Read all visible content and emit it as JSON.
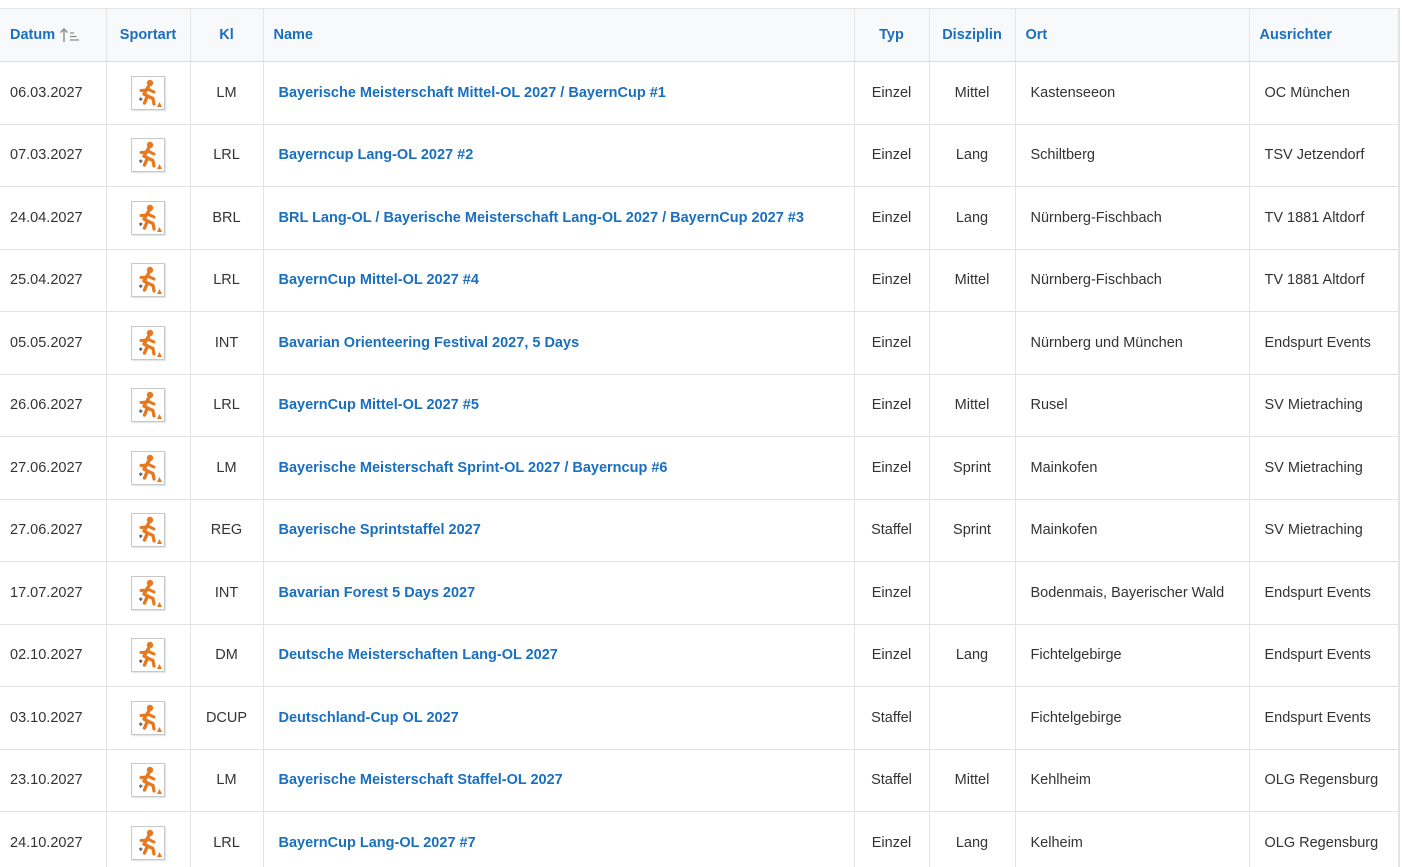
{
  "headers": {
    "datum": "Datum",
    "sportart": "Sportart",
    "kl": "Kl",
    "name": "Name",
    "typ": "Typ",
    "disziplin": "Disziplin",
    "ort": "Ort",
    "ausrichter": "Ausrichter"
  },
  "sort": {
    "column": "Datum",
    "direction": "ascending",
    "icon": "sort-ascending-icon"
  },
  "sport_icon": "orienteering-runner-icon",
  "colors": {
    "link": "#1a6fbf",
    "icon_orange": "#e8781e",
    "header_bg": "#f8f9fb"
  },
  "rows": [
    {
      "datum": "06.03.2027",
      "kl": "LM",
      "name": "Bayerische Meisterschaft Mittel-OL 2027 / BayernCup #1",
      "typ": "Einzel",
      "disziplin": "Mittel",
      "ort": "Kastenseeon",
      "ausrichter": "OC München"
    },
    {
      "datum": "07.03.2027",
      "kl": "LRL",
      "name": "Bayerncup Lang-OL 2027 #2",
      "typ": "Einzel",
      "disziplin": "Lang",
      "ort": "Schiltberg",
      "ausrichter": "TSV Jetzendorf"
    },
    {
      "datum": "24.04.2027",
      "kl": "BRL",
      "name": "BRL Lang-OL / Bayerische Meisterschaft Lang-OL 2027 / BayernCup 2027 #3",
      "typ": "Einzel",
      "disziplin": "Lang",
      "ort": "Nürnberg-Fischbach",
      "ausrichter": "TV 1881 Altdorf"
    },
    {
      "datum": "25.04.2027",
      "kl": "LRL",
      "name": "BayernCup Mittel-OL 2027 #4",
      "typ": "Einzel",
      "disziplin": "Mittel",
      "ort": "Nürnberg-Fischbach",
      "ausrichter": "TV 1881 Altdorf"
    },
    {
      "datum": "05.05.2027",
      "kl": "INT",
      "name": "Bavarian Orienteering Festival 2027, 5 Days",
      "typ": "Einzel",
      "disziplin": "",
      "ort": "Nürnberg und München",
      "ausrichter": "Endspurt Events"
    },
    {
      "datum": "26.06.2027",
      "kl": "LRL",
      "name": "BayernCup Mittel-OL 2027 #5",
      "typ": "Einzel",
      "disziplin": "Mittel",
      "ort": "Rusel",
      "ausrichter": "SV Mietraching"
    },
    {
      "datum": "27.06.2027",
      "kl": "LM",
      "name": "Bayerische Meisterschaft Sprint-OL 2027 / Bayerncup #6",
      "typ": "Einzel",
      "disziplin": "Sprint",
      "ort": "Mainkofen",
      "ausrichter": "SV Mietraching"
    },
    {
      "datum": "27.06.2027",
      "kl": "REG",
      "name": "Bayerische Sprintstaffel 2027",
      "typ": "Staffel",
      "disziplin": "Sprint",
      "ort": "Mainkofen",
      "ausrichter": "SV Mietraching"
    },
    {
      "datum": "17.07.2027",
      "kl": "INT",
      "name": "Bavarian Forest 5 Days 2027",
      "typ": "Einzel",
      "disziplin": "",
      "ort": "Bodenmais, Bayerischer Wald",
      "ausrichter": "Endspurt Events"
    },
    {
      "datum": "02.10.2027",
      "kl": "DM",
      "name": "Deutsche Meisterschaften Lang-OL 2027",
      "typ": "Einzel",
      "disziplin": "Lang",
      "ort": "Fichtelgebirge",
      "ausrichter": "Endspurt Events"
    },
    {
      "datum": "03.10.2027",
      "kl": "DCUP",
      "name": "Deutschland-Cup OL 2027",
      "typ": "Staffel",
      "disziplin": "",
      "ort": "Fichtelgebirge",
      "ausrichter": "Endspurt Events"
    },
    {
      "datum": "23.10.2027",
      "kl": "LM",
      "name": "Bayerische Meisterschaft Staffel-OL 2027",
      "typ": "Staffel",
      "disziplin": "Mittel",
      "ort": "Kehlheim",
      "ausrichter": "OLG Regensburg"
    },
    {
      "datum": "24.10.2027",
      "kl": "LRL",
      "name": "BayernCup Lang-OL 2027 #7",
      "typ": "Einzel",
      "disziplin": "Lang",
      "ort": "Kelheim",
      "ausrichter": "OLG Regensburg"
    }
  ]
}
